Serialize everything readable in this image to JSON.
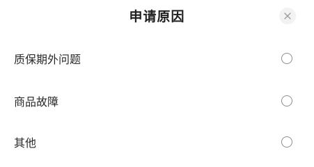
{
  "dialog": {
    "title": "申请原因",
    "close_icon": "close-icon"
  },
  "options": [
    {
      "label": "质保期外问题",
      "selected": false
    },
    {
      "label": "商品故障",
      "selected": false
    },
    {
      "label": "其他",
      "selected": false
    }
  ],
  "colors": {
    "background": "#ffffff",
    "text": "#2a2a2a",
    "radio_border": "#8c8c8c",
    "close_bg": "#f2f2f2",
    "close_glyph": "#9a9a9a"
  }
}
